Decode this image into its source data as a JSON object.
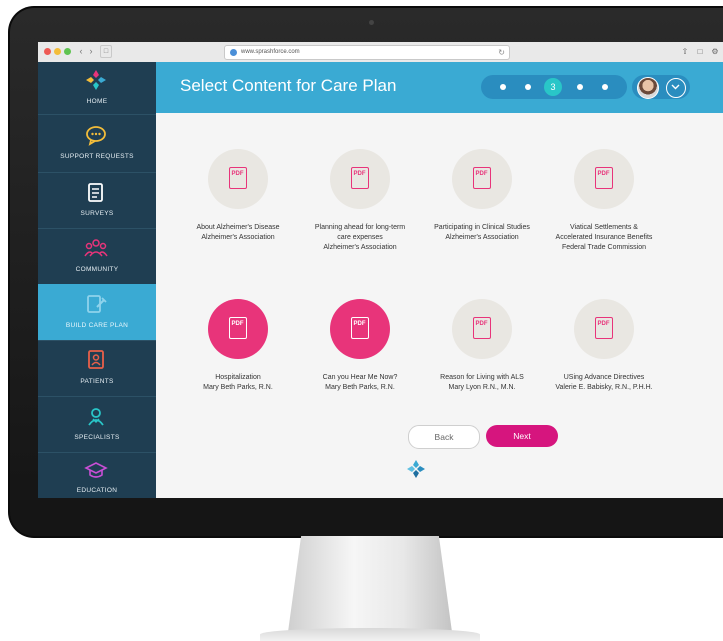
{
  "browser": {
    "url": "www.sprashforce.com"
  },
  "sidebar": {
    "items": [
      {
        "label": "HOME",
        "icon": "home-logo-icon"
      },
      {
        "label": "SUPPORT REQUESTS",
        "icon": "chat-bubble-icon"
      },
      {
        "label": "SURVEYS",
        "icon": "document-icon"
      },
      {
        "label": "COMMUNITY",
        "icon": "community-icon"
      },
      {
        "label": "BUILD CARE PLAN",
        "icon": "build-plan-icon"
      },
      {
        "label": "PATIENTS",
        "icon": "patient-card-icon"
      },
      {
        "label": "SPECIALISTS",
        "icon": "specialist-icon"
      },
      {
        "label": "EDUCATION",
        "icon": "graduation-cap-icon"
      }
    ],
    "active_index": 4
  },
  "header": {
    "title": "Select Content for Care Plan",
    "current_step": "3"
  },
  "cards": [
    {
      "lines": [
        "About Alzheimer's Disease",
        "Alzheimer's Association"
      ],
      "highlighted": false,
      "icon_text": "PDF"
    },
    {
      "lines": [
        "Planning ahead for long-term",
        "care expenses",
        "Alzheimer's Association"
      ],
      "highlighted": false,
      "icon_text": "PDF"
    },
    {
      "lines": [
        "Participating in Clinical Studies",
        "Alzheimer's Association"
      ],
      "highlighted": false,
      "icon_text": "PDF"
    },
    {
      "lines": [
        "Viatical Settlements &",
        "Accelerated Insurance Benefits",
        "Federal Trade Commission"
      ],
      "highlighted": false,
      "icon_text": "PDF"
    },
    {
      "lines": [
        "Hospitalization",
        "Mary Beth Parks, R.N."
      ],
      "highlighted": true,
      "icon_text": "PDF"
    },
    {
      "lines": [
        "Can you Hear Me Now?",
        "Mary Beth Parks, R.N."
      ],
      "highlighted": true,
      "icon_text": "PDF"
    },
    {
      "lines": [
        "Reason for Living with ALS",
        "Mary Lyon R.N., M.N."
      ],
      "highlighted": false,
      "icon_text": "PDF"
    },
    {
      "lines": [
        "USing Advance Directives",
        "Valerie E. Babisky, R.N., P.H.H."
      ],
      "highlighted": false,
      "icon_text": "PDF"
    }
  ],
  "buttons": {
    "back": "Back",
    "next": "Next"
  },
  "colors": {
    "sidebar_bg": "#1f3e52",
    "header_bg": "#3aaad3",
    "accent_pink": "#e8347a",
    "next_button": "#d6157e",
    "step_active": "#29c6c8"
  }
}
